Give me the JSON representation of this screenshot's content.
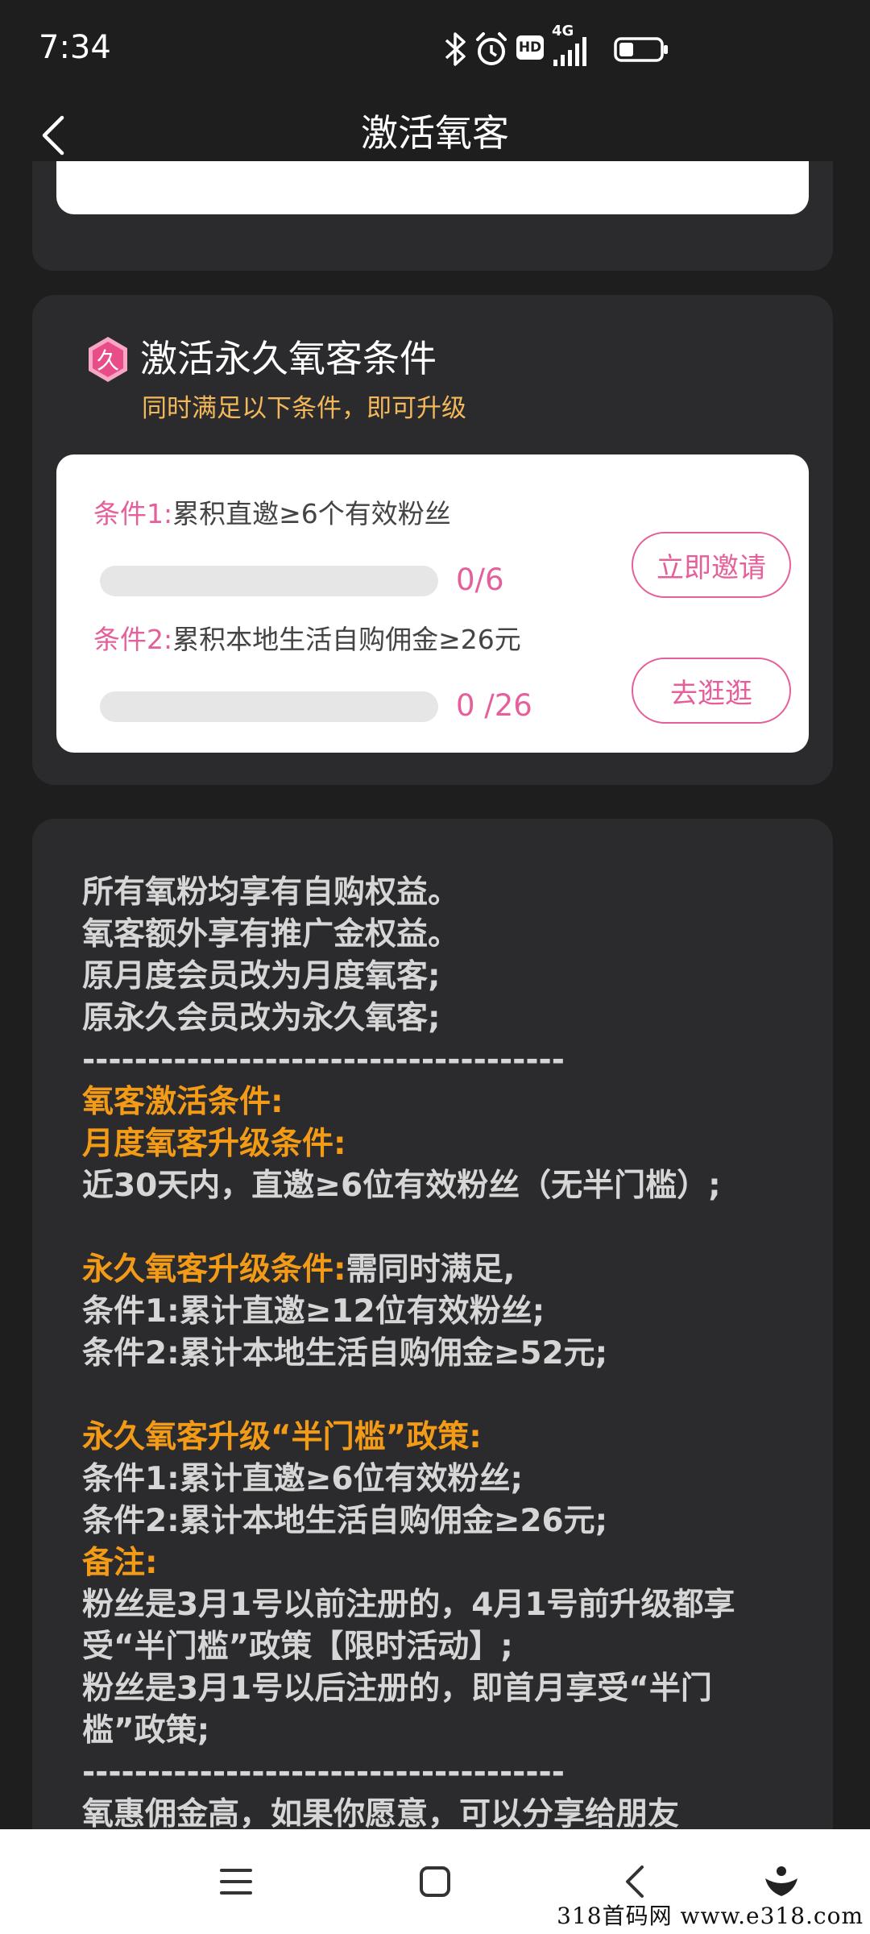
{
  "status_bar": {
    "time": "7:34",
    "network": "4G",
    "hd": "HD",
    "battery_level": 0.35
  },
  "header": {
    "title": "激活氧客"
  },
  "conditions": {
    "badge_char": "久",
    "title": "激活永久氧客条件",
    "subtitle": "同时满足以下条件，即可升级",
    "items": [
      {
        "prefix": "条件1:",
        "desc": "累积直邀≥6个有效粉丝",
        "progress_text": "0/6",
        "progress_fraction": 0,
        "button": "立即邀请"
      },
      {
        "prefix": "条件2:",
        "desc": "累积本地生活自购佣金≥26元",
        "progress_text": "0 /26",
        "progress_fraction": 0,
        "button": "去逛逛"
      }
    ]
  },
  "info": {
    "lines": [
      {
        "text": "所有氧粉均享有自购权益。"
      },
      {
        "text": "氧客额外享有推广金权益。"
      },
      {
        "text": "原月度会员改为月度氧客;"
      },
      {
        "text": "原永久会员改为永久氧客;"
      },
      {
        "text": "-------------------------------------"
      },
      {
        "hl": "氧客激活条件:"
      },
      {
        "hl": "月度氧客升级条件:"
      },
      {
        "text": "近30天内，直邀≥6位有效粉丝（无半门槛）;"
      },
      {
        "blank": true
      },
      {
        "hl": "永久氧客升级条件:",
        "text": "需同时满足,"
      },
      {
        "text": "条件1:累计直邀≥12位有效粉丝;"
      },
      {
        "text": "条件2:累计本地生活自购佣金≥52元;"
      },
      {
        "blank": true
      },
      {
        "hl": "永久氧客升级“半门槛”政策:"
      },
      {
        "text": "条件1:累计直邀≥6位有效粉丝;"
      },
      {
        "text": "条件2:累计本地生活自购佣金≥26元;"
      },
      {
        "hl": "备注:"
      },
      {
        "text": "粉丝是3月1号以前注册的，4月1号前升级都享"
      },
      {
        "text": "受“半门槛”政策【限时活动】;"
      },
      {
        "text": "粉丝是3月1号以后注册的，即首月享受“半门"
      },
      {
        "text": "槛”政策;"
      },
      {
        "text": "-------------------------------------"
      },
      {
        "text": "氧惠佣金高，如果你愿意，可以分享给朋友"
      }
    ]
  },
  "watermark": "318首码网  www.e318.com"
}
